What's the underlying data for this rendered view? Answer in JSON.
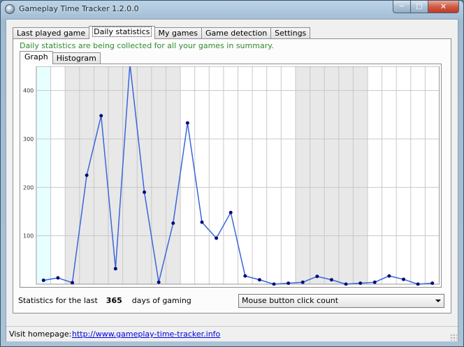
{
  "window": {
    "title": "Gameplay Time Tracker 1.2.0.0"
  },
  "tabs": [
    {
      "label": "Last played game",
      "active": false
    },
    {
      "label": "Daily statistics",
      "active": true
    },
    {
      "label": "My games",
      "active": false
    },
    {
      "label": "Game detection",
      "active": false
    },
    {
      "label": "Settings",
      "active": false
    }
  ],
  "info_text": "Daily statistics are being collected for all your games in summary.",
  "subtabs": [
    {
      "label": "Graph",
      "active": true
    },
    {
      "label": "Histogram",
      "active": false
    }
  ],
  "stats": {
    "prefix": "Statistics for the last",
    "days": "365",
    "suffix": "days of gaming"
  },
  "metric_select": {
    "value": "Mouse button click count"
  },
  "status": {
    "label": "Visit homepage:",
    "link": "http://www.gameplay-time-tracker.info"
  },
  "colors": {
    "line": "#3a66d8",
    "point": "#0a0a7a",
    "highlight_col": "#e8ffff",
    "shaded_col": "#e8e8e8",
    "info_text": "#2e8b2e"
  },
  "chart_data": {
    "type": "line",
    "title": "",
    "xlabel": "",
    "ylabel": "",
    "ylim": [
      0,
      450
    ],
    "yticks": [
      100,
      200,
      300,
      400
    ],
    "grid": true,
    "x": [
      1,
      2,
      3,
      4,
      5,
      6,
      7,
      8,
      9,
      10,
      11,
      12,
      13,
      14,
      15,
      16,
      17,
      18,
      19,
      20,
      21,
      22,
      23,
      24,
      25,
      26,
      27,
      28
    ],
    "values": [
      8,
      13,
      3,
      225,
      348,
      32,
      455,
      190,
      4,
      126,
      333,
      128,
      95,
      148,
      17,
      9,
      0,
      2,
      4,
      16,
      9,
      0,
      2,
      4,
      17,
      10,
      0,
      2
    ],
    "shaded_columns": [
      3,
      4,
      5,
      6,
      7,
      8,
      9,
      10,
      19,
      20,
      21,
      22,
      23
    ]
  }
}
